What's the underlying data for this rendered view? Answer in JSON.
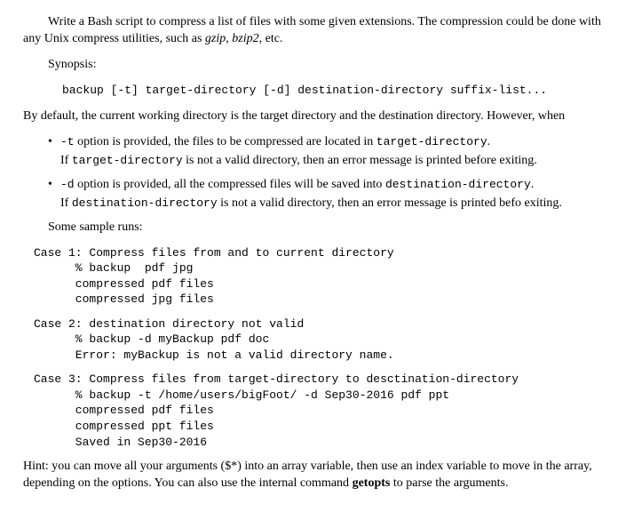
{
  "intro": {
    "part1": "Write a Bash script to compress a list of files with some given extensions. The compression could be done with any Unix compress utilities, such as ",
    "em1": "gzip",
    "sep": ", ",
    "em2": "bzip2",
    "part2": ", etc."
  },
  "synopsis_label": "Synopsis:",
  "synopsis_cmd": "backup  [-t] target-directory [-d] destination-directory suffix-list...",
  "default_line": "By default, the current working directory is the target directory and the destination directory. However, when",
  "bullets": [
    {
      "opt": "-t",
      "line1_mid": " option is provided, the files to be compressed are located in ",
      "line1_code": "target-directory",
      "line1_end": ".",
      "line2_pre": "If ",
      "line2_code": "target-directory",
      "line2_post": " is not a valid directory, then an error message is printed before exiting."
    },
    {
      "opt": "-d",
      "line1_mid": " option is provided, all the compressed files will be saved into ",
      "line1_code": "destination-directory",
      "line1_end": ".",
      "line2_pre": "If ",
      "line2_code": "destination-directory",
      "line2_post": " is not a valid directory, then an error message is printed befo exiting."
    }
  ],
  "sample_runs_label": "Some sample runs:",
  "case1": "Case 1: Compress files from and to current directory\n      % backup  pdf jpg\n      compressed pdf files\n      compressed jpg files",
  "case2": "Case 2: destination directory not valid\n      % backup -d myBackup pdf doc\n      Error: myBackup is not a valid directory name.",
  "case3": "Case 3: Compress files from target-directory to desctination-directory\n      % backup -t /home/users/bigFoot/ -d Sep30-2016 pdf ppt\n      compressed pdf files\n      compressed ppt files\n      Saved in Sep30-2016",
  "hint": {
    "pre": "Hint: you can move all your arguments ($*) into an array variable, then use an index variable to move in the array, depending on the options. You can also use the internal command ",
    "bold": "getopts",
    "post": " to parse the arguments."
  }
}
